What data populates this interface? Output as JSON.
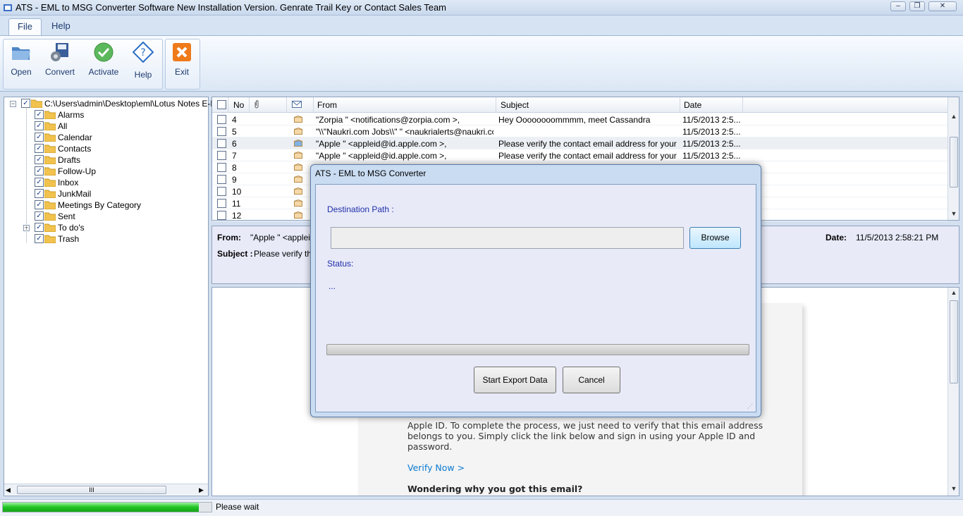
{
  "window": {
    "title": "ATS - EML to MSG Converter Software New Installation Version. Genrate Trail Key or Contact Sales Team",
    "controls": [
      "–",
      "❐",
      "✕"
    ]
  },
  "ribbon": {
    "tabs": [
      "File",
      "Help"
    ],
    "buttons": {
      "open": "Open",
      "convert": "Convert",
      "activate": "Activate",
      "help": "Help",
      "exit": "Exit"
    }
  },
  "tree": {
    "root": "C:\\Users\\admin\\Desktop\\eml\\Lotus Notes E-Mai",
    "items": [
      "Alarms",
      "All",
      "Calendar",
      "Contacts",
      "Drafts",
      "Follow-Up",
      "Inbox",
      "JunkMail",
      "Meetings By Category",
      "Sent",
      "To do's",
      "Trash"
    ],
    "scroll_marker": "III"
  },
  "grid": {
    "columns": {
      "no": "No",
      "from": "From",
      "subject": "Subject",
      "date": "Date"
    },
    "rows": [
      {
        "no": "4",
        "from": "\"Zorpia \" <notifications@zorpia.com >,",
        "subject": "Hey Oooooooommmm, meet Cassandra",
        "date": "11/5/2013 2:5..."
      },
      {
        "no": "5",
        "from": "\"\\\\\"Naukri.com Jobs\\\\\" \" <naukrialerts@naukri.co...",
        "subject": "",
        "date": "11/5/2013 2:5..."
      },
      {
        "no": "6",
        "from": "\"Apple \" <appleid@id.apple.com >,",
        "subject": "Please verify the contact email address for your App...",
        "date": "11/5/2013 2:5..."
      },
      {
        "no": "7",
        "from": "\"Apple \" <appleid@id.apple.com >,",
        "subject": "Please verify the contact email address for your App...",
        "date": "11/5/2013 2:5..."
      },
      {
        "no": "8",
        "from": "",
        "subject": "",
        "date": ""
      },
      {
        "no": "9",
        "from": "",
        "subject": "",
        "date": ""
      },
      {
        "no": "10",
        "from": "",
        "subject": "",
        "date": ""
      },
      {
        "no": "11",
        "from": "",
        "subject": "",
        "date": ""
      },
      {
        "no": "12",
        "from": "",
        "subject": "",
        "date": ""
      }
    ]
  },
  "header_panel": {
    "from_label": "From:",
    "from_value": "\"Apple \" <appleid",
    "subject_label": "Subject :",
    "subject_value": "Please verify the",
    "date_label": "Date:",
    "date_value": "11/5/2013 2:58:21 PM"
  },
  "body": {
    "line1": "Apple ID. To complete the process, we just need to verify that this email address",
    "line2": "belongs to you. Simply click the link below and sign in using your Apple ID and",
    "line3": "password.",
    "link": "Verify Now >",
    "heading": "Wondering why you got this email?"
  },
  "status": {
    "text": "Please wait",
    "progress": 0.94
  },
  "dialog": {
    "title": "ATS - EML to MSG Converter",
    "destination_label": "Destination Path :",
    "destination_value": "",
    "browse": "Browse",
    "status_label": "Status:",
    "status_value": "...",
    "start": "Start Export Data",
    "cancel": "Cancel"
  }
}
